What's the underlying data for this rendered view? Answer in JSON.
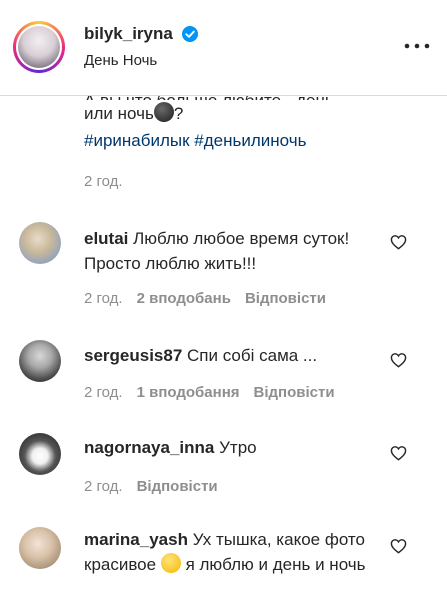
{
  "header": {
    "username": "bilyk_iryna",
    "subtitle": "День Ночь",
    "icons": {
      "verified": "verified-badge-icon",
      "more": "more-options-icon"
    }
  },
  "caption": {
    "line1": "А вы что больше любите - день",
    "line2_text": "или ночь",
    "line2_suffix": "?",
    "hashtags": "#иринабилык #деньилиночь",
    "time": "2 год."
  },
  "comments": [
    {
      "username": "elutai",
      "text": "Люблю любое время суток! Просто люблю жить!!!",
      "time": "2 год.",
      "likes": "2 вподобань",
      "reply": "Відповісти"
    },
    {
      "username": "sergeusis87",
      "text": "Спи собі сама ...",
      "time": "2 год.",
      "likes": "1 вподобання",
      "reply": "Відповісти"
    },
    {
      "username": "nagornaya_inna",
      "text": "Утро",
      "time": "2 год.",
      "likes": "",
      "reply": "Відповісти"
    },
    {
      "username": "marina_yash",
      "text_before_emoji": "Ух тышка, какое фото красивое",
      "text_after_emoji": "я люблю и день и ночь",
      "time": "",
      "likes": "",
      "reply": ""
    }
  ],
  "colors": {
    "text": "#262626",
    "muted": "#8e8e8e",
    "hashtag": "#00376b",
    "verified": "#0095f6",
    "border": "#dbdbdb"
  }
}
